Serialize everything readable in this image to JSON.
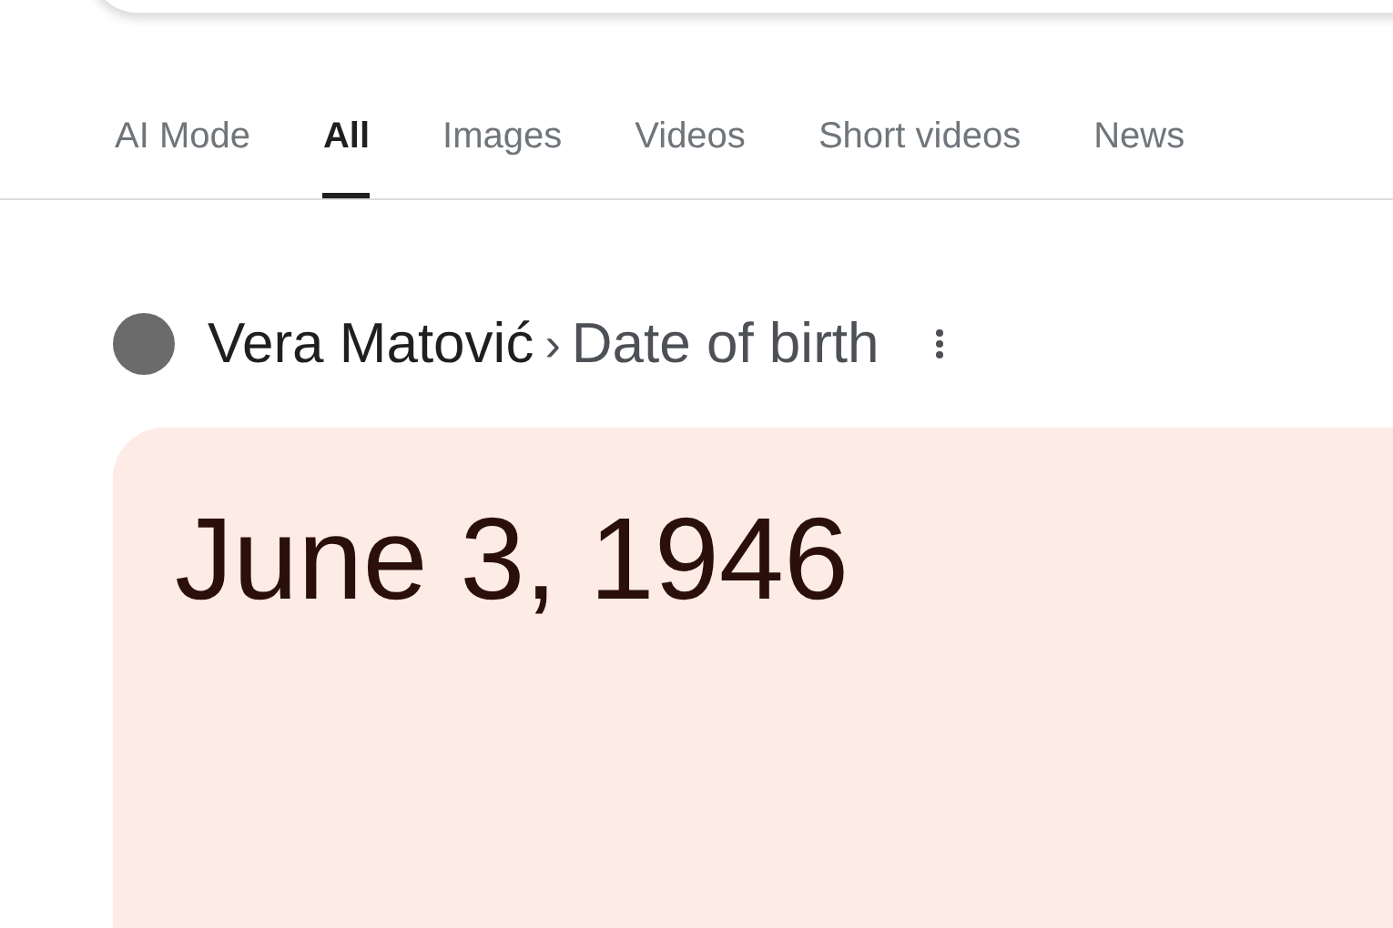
{
  "tabs": [
    {
      "label": "AI Mode",
      "selected": false
    },
    {
      "label": "All",
      "selected": true
    },
    {
      "label": "Images",
      "selected": false
    },
    {
      "label": "Videos",
      "selected": false
    },
    {
      "label": "Short videos",
      "selected": false
    },
    {
      "label": "News",
      "selected": false
    }
  ],
  "breadcrumb": {
    "entity": "Vera Matović",
    "separator": "›",
    "attribute": "Date of birth"
  },
  "answer_card": {
    "value": "June 3, 1946"
  }
}
